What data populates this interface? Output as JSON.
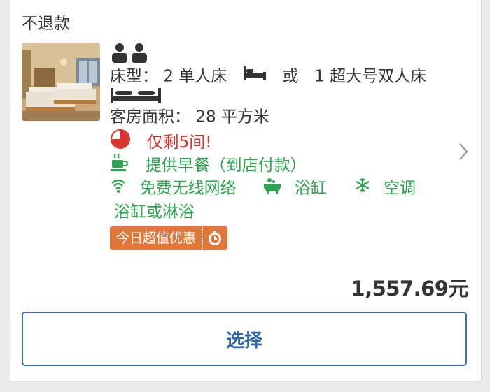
{
  "room": {
    "policy": "不退款",
    "bed_label": "床型：",
    "bed_option_1": "2 单人床",
    "bed_or": "或",
    "bed_option_2": "1 超大号双人床",
    "area_label": "客房面积：",
    "area_value": "28 平方米",
    "scarcity": "仅剩5间!",
    "breakfast": "提供早餐（到店付款）",
    "amenities": [
      {
        "icon": "wifi-icon",
        "label": "免费无线网络"
      },
      {
        "icon": "bathtub-icon",
        "label": "浴缸"
      },
      {
        "icon": "snowflake-icon",
        "label": "空调"
      }
    ],
    "amenity_extra": "浴缸或淋浴",
    "deal_badge": "今日超值优惠",
    "price": "1,557.69元",
    "select_label": "选择"
  },
  "colors": {
    "green": "#2ea44f",
    "red": "#d9342b",
    "orange": "#e0773a",
    "blue": "#3a70b3"
  }
}
